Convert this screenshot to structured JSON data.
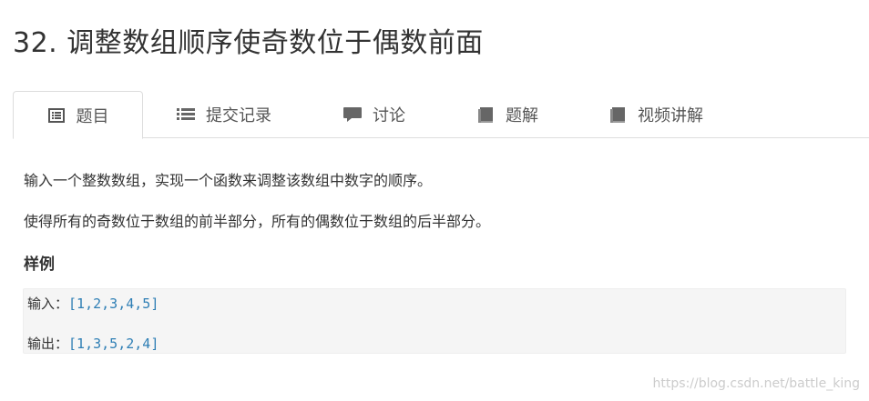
{
  "page": {
    "title": "32. 调整数组顺序使奇数位于偶数前面"
  },
  "tabs": [
    {
      "label": "题目",
      "icon": "document-list-icon",
      "active": true
    },
    {
      "label": "提交记录",
      "icon": "list-icon",
      "active": false
    },
    {
      "label": "讨论",
      "icon": "comment-icon",
      "active": false
    },
    {
      "label": "题解",
      "icon": "book-icon",
      "active": false
    },
    {
      "label": "视频讲解",
      "icon": "book-icon",
      "active": false
    }
  ],
  "problem": {
    "paragraphs": [
      "输入一个整数数组，实现一个函数来调整该数组中数字的顺序。",
      "使得所有的奇数位于数组的前半部分，所有的偶数位于数组的后半部分。"
    ],
    "example_heading": "样例",
    "example": {
      "input_label": "输入",
      "input_colon": "：",
      "input_value": "[1,2,3,4,5]",
      "output_label": "输出",
      "output_colon": "：",
      "output_value": "[1,3,5,2,4]"
    }
  },
  "watermark": "https://blog.csdn.net/battle_king",
  "colors": {
    "text": "#333333",
    "tab_border": "#dddddd",
    "code_bg": "#f5f5f5",
    "code_value": "#2f7fb5",
    "icon": "#666666"
  }
}
